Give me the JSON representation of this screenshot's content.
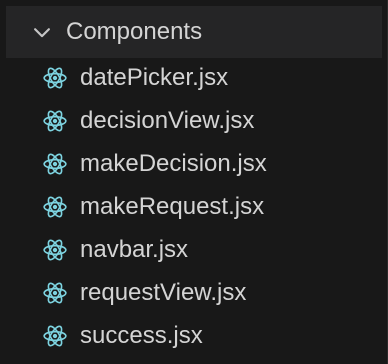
{
  "explorer": {
    "folder": {
      "label": "Components",
      "expanded": true,
      "chevron_icon": "chevron-down-icon"
    },
    "colors": {
      "background": "#181818",
      "folder_row_bg": "#252526",
      "text": "#d4d4d4",
      "react_icon": "#7dd3e0"
    },
    "files": [
      {
        "label": "datePicker.jsx",
        "icon": "react-icon"
      },
      {
        "label": "decisionView.jsx",
        "icon": "react-icon"
      },
      {
        "label": "makeDecision.jsx",
        "icon": "react-icon"
      },
      {
        "label": "makeRequest.jsx",
        "icon": "react-icon"
      },
      {
        "label": "navbar.jsx",
        "icon": "react-icon"
      },
      {
        "label": "requestView.jsx",
        "icon": "react-icon"
      },
      {
        "label": "success.jsx",
        "icon": "react-icon"
      }
    ]
  }
}
